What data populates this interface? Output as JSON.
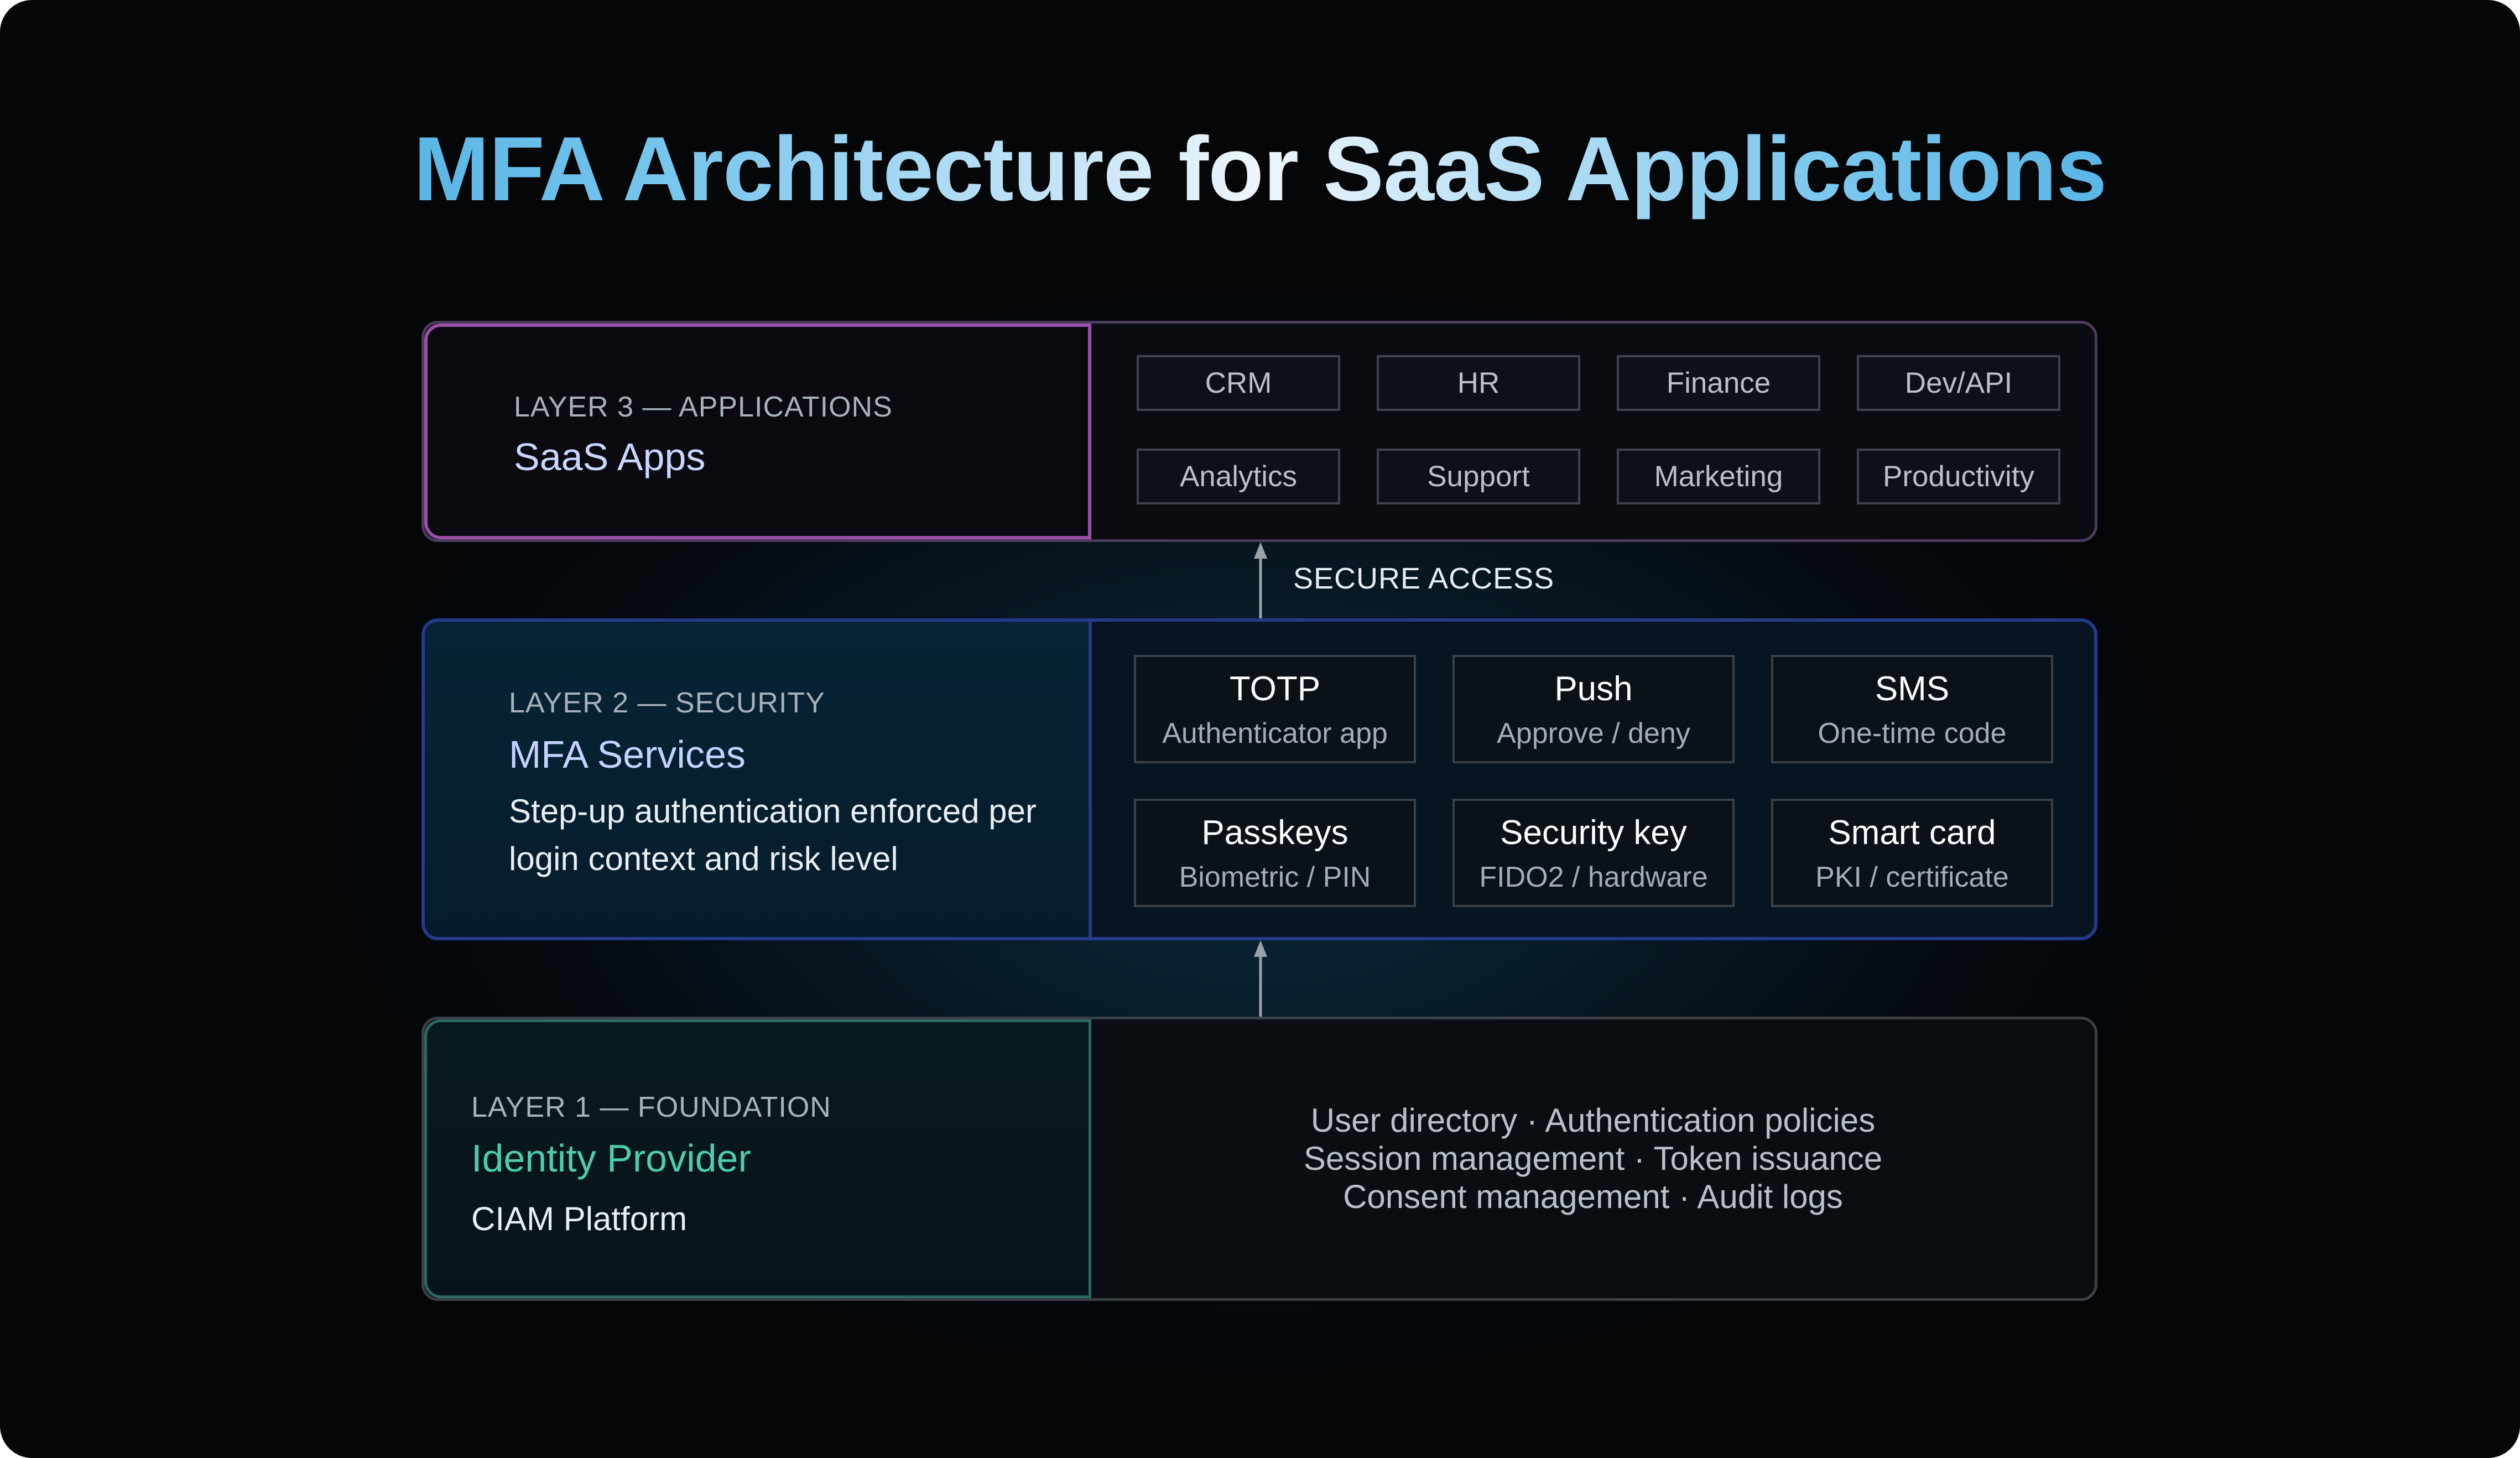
{
  "title": "MFA Architecture for SaaS Applications",
  "layers": {
    "applications": {
      "eyebrow": "LAYER 3 — APPLICATIONS",
      "name": "SaaS Apps",
      "apps": [
        "CRM",
        "HR",
        "Finance",
        "Dev/API",
        "Analytics",
        "Support",
        "Marketing",
        "Productivity"
      ]
    },
    "security": {
      "eyebrow": "LAYER 2 — SECURITY",
      "name": "MFA Services",
      "description": "Step-up authentication enforced per login context and risk level",
      "methods": [
        {
          "name": "TOTP",
          "detail": "Authenticator app"
        },
        {
          "name": "Push",
          "detail": "Approve / deny"
        },
        {
          "name": "SMS",
          "detail": "One-time code"
        },
        {
          "name": "Passkeys",
          "detail": "Biometric / PIN"
        },
        {
          "name": "Security key",
          "detail": "FIDO2 / hardware"
        },
        {
          "name": "Smart card",
          "detail": "PKI / certificate"
        }
      ]
    },
    "foundation": {
      "eyebrow": "LAYER 1 — FOUNDATION",
      "name": "Identity Provider",
      "description": "CIAM Platform",
      "capabilities": [
        "User directory · Authentication policies",
        "Session management · Token issuance",
        "Consent management · Audit logs"
      ]
    }
  },
  "connectors": {
    "secure_access": "SECURE ACCESS"
  },
  "colors": {
    "layer3_accent": "#9b4fa6",
    "layer2_accent": "#243a8a",
    "layer1_accent": "#2a6b62",
    "layer1_name": "#4dcdb0",
    "title_gradient": [
      "#2a9fd8",
      "#eef5fb"
    ]
  }
}
